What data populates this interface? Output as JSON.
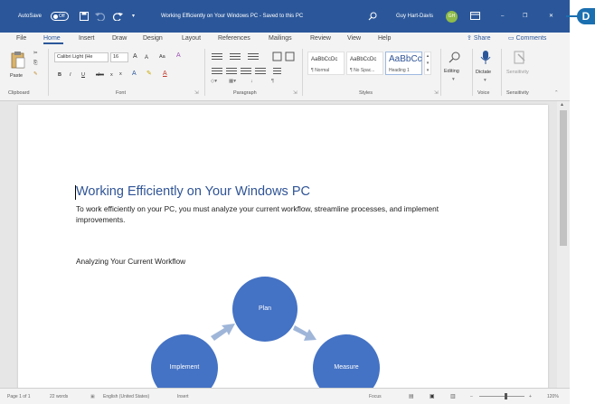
{
  "titlebar": {
    "autosave_label": "AutoSave",
    "autosave_state": "Off",
    "save_icon": "save-icon",
    "undo_icon": "undo-icon",
    "redo_icon": "redo-icon",
    "customize_icon": "chevron-down-icon",
    "doc_title": "Working Efficiently on Your Windows PC - Saved to this PC",
    "user_name": "Guy Hart-Davis",
    "user_initials": "GH",
    "ribbon_display_icon": "ribbon-display-icon",
    "minimize_glyph": "–",
    "restore_glyph": "❐",
    "close_glyph": "✕",
    "brand_color": "#2b579a"
  },
  "callout": {
    "letter": "D",
    "color": "#1a6fb0"
  },
  "tabs": {
    "items": [
      "File",
      "Home",
      "Insert",
      "Draw",
      "Design",
      "Layout",
      "References",
      "Mailings",
      "Review",
      "View",
      "Help"
    ],
    "active": "Home",
    "share": "Share",
    "comments": "Comments"
  },
  "ribbon": {
    "clipboard": {
      "paste": "Paste",
      "label": "Clipboard"
    },
    "font": {
      "font_name": "Calibri Light (He",
      "font_size": "16",
      "grow": "A",
      "shrink": "A",
      "case": "Aa",
      "bold": "B",
      "italic": "I",
      "underline": "U",
      "strike": "abc",
      "subscript": "x",
      "superscript": "x",
      "label": "Font"
    },
    "paragraph": {
      "label": "Paragraph"
    },
    "styles": {
      "items": [
        {
          "sample": "AaBbCcDc",
          "name": "¶ Normal"
        },
        {
          "sample": "AaBbCcDc",
          "name": "¶ No Spac..."
        },
        {
          "sample": "AaBbCc",
          "name": "Heading 1"
        }
      ],
      "label": "Styles"
    },
    "editing": {
      "label": "Editing"
    },
    "voice": {
      "dictate": "Dictate",
      "label": "Voice"
    },
    "sensitivity": {
      "button": "Sensitivity",
      "label": "Sensitivity"
    }
  },
  "document": {
    "heading": "Working Efficiently on Your Windows PC",
    "heading_color": "#2f5496",
    "body": "To work efficiently on your PC, you must analyze your current workflow, streamline processes, and implement improvements.",
    "subheading": "Analyzing Your Current Workflow",
    "diagram": {
      "nodes": [
        "Plan",
        "Implement",
        "Measure"
      ],
      "node_color": "#4472c4",
      "arrow_color": "#9fb6d9"
    }
  },
  "statusbar": {
    "page": "Page 1 of 1",
    "words": "22 words",
    "language": "English (United States)",
    "mode": "Insert",
    "focus": "Focus",
    "zoom": "120%"
  }
}
